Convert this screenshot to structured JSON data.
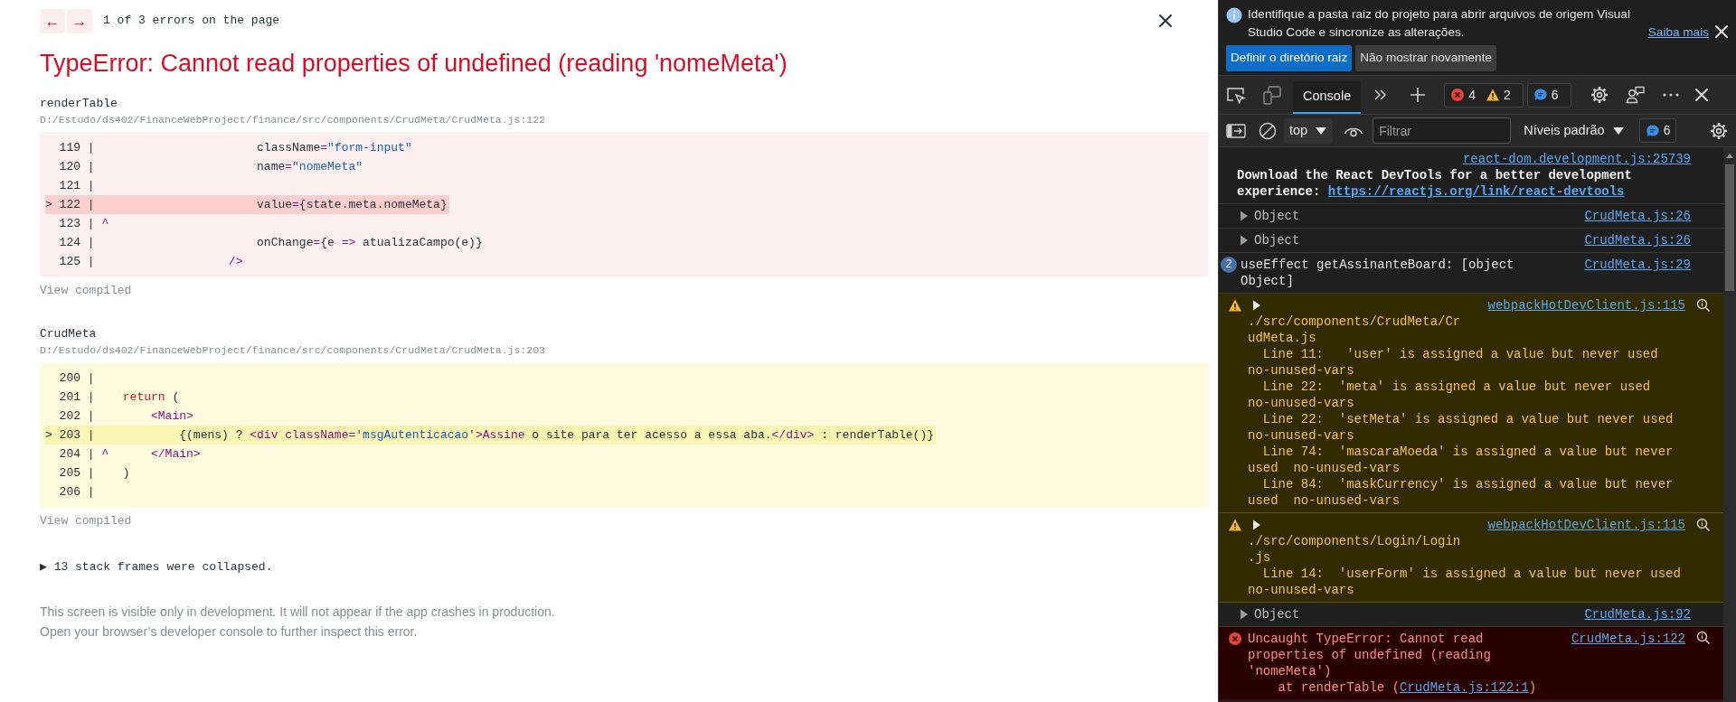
{
  "overlay": {
    "nav": {
      "prev": "←",
      "next": "→",
      "counter": "1 of 3 errors on the page"
    },
    "title": "TypeError: Cannot read properties of undefined (reading 'nomeMeta')",
    "frames": [
      {
        "function": "renderTable",
        "path": "D:/Estudo/ds402/FinanceWebProject/finance/src/components/CrudMeta/CrudMeta.js:122",
        "kind": "primary",
        "view_compiled": "View compiled",
        "lines": [
          {
            "gutter": "  119 |",
            "highlighted": false,
            "tokens": [
              {
                "kind": "plain",
                "text": "                       className"
              },
              {
                "kind": "punct",
                "text": "="
              },
              {
                "kind": "string",
                "text": "\"form-input\""
              }
            ]
          },
          {
            "gutter": "  120 |",
            "highlighted": false,
            "tokens": [
              {
                "kind": "plain",
                "text": "                       name"
              },
              {
                "kind": "punct",
                "text": "="
              },
              {
                "kind": "string",
                "text": "\"nomeMeta\""
              }
            ]
          },
          {
            "gutter": "  121 |",
            "highlighted": false
          },
          {
            "gutter": "> 122 |",
            "highlighted": true,
            "tokens": [
              {
                "kind": "plain",
                "text": "                       value"
              },
              {
                "kind": "punct",
                "text": "="
              },
              {
                "kind": "plain",
                "text": "{state.meta.nomeMeta}"
              }
            ]
          },
          {
            "gutter": "  123 |",
            "highlighted": false,
            "tokens": [
              {
                "kind": "punct",
                "text": " ^"
              }
            ]
          },
          {
            "gutter": "  124 |",
            "highlighted": false,
            "tokens": [
              {
                "kind": "plain",
                "text": "                       onChange"
              },
              {
                "kind": "punct",
                "text": "="
              },
              {
                "kind": "plain",
                "text": "{e "
              },
              {
                "kind": "punct",
                "text": "=>"
              },
              {
                "kind": "plain",
                "text": " atualizaCampo(e)}"
              }
            ]
          },
          {
            "gutter": "  125 |",
            "highlighted": false,
            "tokens": [
              {
                "kind": "punct",
                "text": "                   />"
              }
            ]
          }
        ]
      },
      {
        "function": "CrudMeta",
        "path": "D:/Estudo/ds402/FinanceWebProject/finance/src/components/CrudMeta/CrudMeta.js:203",
        "kind": "secondary",
        "view_compiled": "View compiled",
        "lines": [
          {
            "gutter": "  200 |",
            "highlighted": false
          },
          {
            "gutter": "  201 |",
            "highlighted": false,
            "tokens": [
              {
                "kind": "keyword",
                "text": "    return"
              },
              {
                "kind": "plain",
                "text": " ("
              }
            ]
          },
          {
            "gutter": "  202 |",
            "highlighted": false,
            "tokens": [
              {
                "kind": "punct",
                "text": "        <Main>"
              }
            ]
          },
          {
            "gutter": "> 203 |",
            "highlighted": true,
            "tokens": [
              {
                "kind": "plain",
                "text": "            {(mens) ? "
              },
              {
                "kind": "punct",
                "text": "<div className="
              },
              {
                "kind": "string",
                "text": "'msgAutenticacao'"
              },
              {
                "kind": "punct",
                "text": ">Assine"
              },
              {
                "kind": "plain",
                "text": " o site para ter acesso a essa aba."
              },
              {
                "kind": "punct",
                "text": "</div>"
              },
              {
                "kind": "plain",
                "text": " : renderTable()}"
              }
            ]
          },
          {
            "gutter": "  204 |",
            "highlighted": false,
            "tokens": [
              {
                "kind": "punct",
                "text": " ^      </Main>"
              }
            ]
          },
          {
            "gutter": "  205 |",
            "highlighted": false,
            "tokens": [
              {
                "kind": "plain",
                "text": "    )"
              }
            ]
          },
          {
            "gutter": "  206 |",
            "highlighted": false
          }
        ]
      }
    ],
    "collapsed": "▶ 13 stack frames were collapsed.",
    "footer": [
      "This screen is visible only in development. It will not appear if the app crashes in production.",
      "Open your browser’s developer console to further inspect this error."
    ]
  },
  "devtools": {
    "infobar": {
      "message": "Identifique a pasta raiz do projeto para abrir arquivos de origem Visual Studio Code e sincronize as alterações.",
      "link": "Saiba mais",
      "buttons": [
        {
          "label": "Definir o diretório raiz",
          "kind": "primary"
        },
        {
          "label": "Não mostrar novamente",
          "kind": "secondary"
        }
      ]
    },
    "tabs": [
      {
        "label": "Console",
        "selected": true
      }
    ],
    "issue_counters": [
      {
        "counts": [
          {
            "kind": "error",
            "count": "4"
          },
          {
            "kind": "warning",
            "count": "2"
          }
        ]
      },
      {
        "counts": [
          {
            "kind": "info",
            "count": "6"
          }
        ]
      }
    ],
    "filter_bar": {
      "context": "top",
      "filter_placeholder": "Filtrar",
      "levels": "Níveis padrão",
      "info_count": "6"
    },
    "messages": [
      {
        "kind": "log",
        "source": "react-dom.development.js:25739",
        "text": "Download the React DevTools for a better development\nexperience: ",
        "link": "https://reactjs.org/link/react-devtools"
      },
      {
        "kind": "object",
        "text": "Object",
        "source": "CrudMeta.js:26"
      },
      {
        "kind": "object",
        "text": "Object",
        "source": "CrudMeta.js:26"
      },
      {
        "kind": "repeat",
        "count": "2",
        "text": "useEffect getAssinanteBoard: [object\nObject]",
        "source": "CrudMeta.js:29"
      },
      {
        "kind": "warning",
        "source": "webpackHotDevClient.js:115",
        "text": "./src/components/CrudMeta/Cr\nudMeta.js\n  Line 11:   'user' is assigned a value but never used\nno-unused-vars\n  Line 22:  'meta' is assigned a value but never used\nno-unused-vars\n  Line 22:  'setMeta' is assigned a value but never used\nno-unused-vars\n  Line 74:  'mascaraMoeda' is assigned a value but never\nused  no-unused-vars\n  Line 84:  'maskCurrency' is assigned a value but never\nused  no-unused-vars"
      },
      {
        "kind": "warning",
        "source": "webpackHotDevClient.js:115",
        "text": "./src/components/Login/Login\n.js\n  Line 14:  'userForm' is assigned a value but never used\nno-unused-vars"
      },
      {
        "kind": "object",
        "text": "Object",
        "source": "CrudMeta.js:92"
      },
      {
        "kind": "error",
        "source": "CrudMeta.js:122",
        "text": "Uncaught TypeError: Cannot read\nproperties of undefined (reading\n'nomeMeta')\n    at renderTable (",
        "link": "CrudMeta.js:122:1",
        "text_after": ")"
      }
    ]
  }
}
